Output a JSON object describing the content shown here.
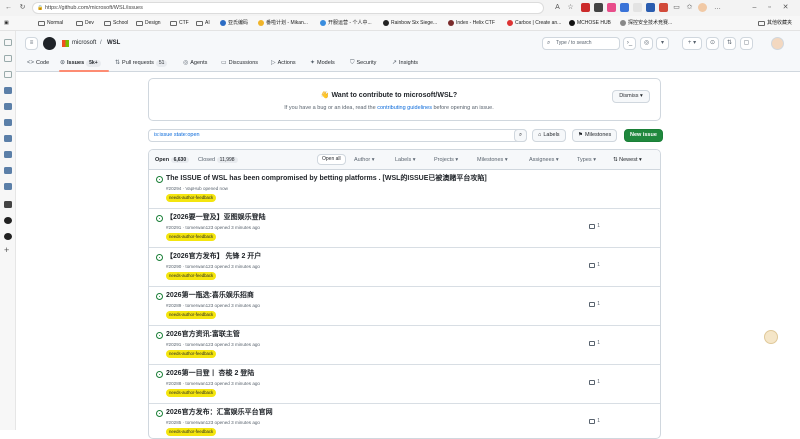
{
  "browser": {
    "url": "https://github.com/microsoft/WSL/issues",
    "bookmarks": [
      "Normal",
      "Dev",
      "School",
      "Design",
      "CTF",
      "AI",
      "亚氏编码",
      "番啦计划 - Mikan...",
      "开服运营 - 个人中...",
      "Rainbow Six Siege...",
      "Index - Helix CTF",
      "Carbox | Create an...",
      "MCHOSE HUB",
      "探控安全技术竞赛..."
    ],
    "other_bookmarks": "其他收藏夹"
  },
  "header": {
    "owner": "microsoft",
    "separator": "/",
    "repo": "WSL",
    "search_placeholder": "Type / to search"
  },
  "tabs": [
    {
      "label": "Code",
      "icon": "code-icon"
    },
    {
      "label": "Issues",
      "count": "5k+",
      "icon": "issue-icon",
      "active": true
    },
    {
      "label": "Pull requests",
      "count": "51",
      "icon": "pull-request-icon"
    },
    {
      "label": "Agents",
      "icon": "agents-icon"
    },
    {
      "label": "Discussions",
      "icon": "discussions-icon"
    },
    {
      "label": "Actions",
      "icon": "actions-icon"
    },
    {
      "label": "Models",
      "icon": "models-icon"
    },
    {
      "label": "Security",
      "icon": "shield-icon"
    },
    {
      "label": "Insights",
      "icon": "graph-icon"
    }
  ],
  "contribute": {
    "title": "👋 Want to contribute to microsoft/WSL?",
    "text_before": "If you have a bug or an idea, read the ",
    "link": "contributing guidelines",
    "text_after": " before opening an issue.",
    "dismiss": "Dismiss"
  },
  "filter": {
    "query_prefix": "is:issue state:",
    "query_value": "open",
    "labels_btn": "Labels",
    "milestones_btn": "Milestones",
    "new_issue_btn": "New issue"
  },
  "list_header": {
    "open_label": "Open",
    "open_count": "6,630",
    "closed_label": "Closed",
    "closed_count": "11,998",
    "open_all": "Open all",
    "filters": [
      "Author",
      "Labels",
      "Projects",
      "Milestones",
      "Assignees",
      "Types"
    ],
    "sort": "Newest"
  },
  "issues": [
    {
      "title": "The ISSUE of WSL has been compromised by betting platforms . [WSL的ISSUE已被澳赌平台攻陷]",
      "meta": "#20294 · VapHub opened now",
      "label": "needs-author-feedback",
      "comments": ""
    },
    {
      "title": "【2026要一登及】亚图娱乐登陆",
      "meta": "#20291 · tomerwan123 opened 3 minutes ago",
      "label": "needs-author-feedback",
      "comments": "1"
    },
    {
      "title": "【2026官方发布】 先锋 2 开户",
      "meta": "#20290 · tomerwan123 opened 3 minutes ago",
      "label": "needs-author-feedback",
      "comments": "1"
    },
    {
      "title": "2026第一瓶选:喜乐娱乐招商",
      "meta": "#20289 · tomerwan123 opened 3 minutes ago",
      "label": "needs-author-feedback",
      "comments": "1"
    },
    {
      "title": "2026官方资讯:富联主管",
      "meta": "#20291 · tomerwan123 opened 3 minutes ago",
      "label": "needs-author-feedback",
      "comments": "1"
    },
    {
      "title": "2026第一目登丨 杏梭 2 登陆",
      "meta": "#20288 · tomerwan123 opened 3 minutes ago",
      "label": "needs-author-feedback",
      "comments": "1"
    },
    {
      "title": "2026官方发布：汇富娱乐平台官网",
      "meta": "#20285 · tomerwan123 opened 3 minutes ago",
      "label": "needs-author-feedback",
      "comments": "1"
    }
  ]
}
